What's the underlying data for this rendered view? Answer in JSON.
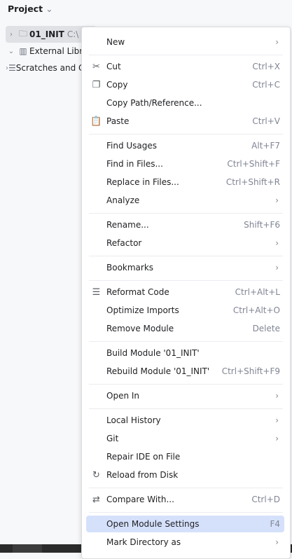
{
  "header": {
    "title": "Project"
  },
  "tree": [
    {
      "label": "01_INIT",
      "path": "C:\\",
      "expanded": false,
      "icon": "module-folder-icon",
      "selected": true
    },
    {
      "label": "External Libraries",
      "expanded": true,
      "icon": "library-icon"
    },
    {
      "label": "Scratches and Consoles",
      "expanded": false,
      "icon": "scratches-icon"
    }
  ],
  "menu": [
    {
      "label": "New",
      "submenu": true
    },
    {
      "sep": true
    },
    {
      "label": "Cut",
      "shortcut": "Ctrl+X",
      "icon": "scissors-icon",
      "glyph": "✂"
    },
    {
      "label": "Copy",
      "shortcut": "Ctrl+C",
      "icon": "copy-icon",
      "glyph": "❐"
    },
    {
      "label": "Copy Path/Reference..."
    },
    {
      "label": "Paste",
      "shortcut": "Ctrl+V",
      "icon": "paste-icon",
      "glyph": "📋"
    },
    {
      "sep": true
    },
    {
      "label": "Find Usages",
      "shortcut": "Alt+F7"
    },
    {
      "label": "Find in Files...",
      "shortcut": "Ctrl+Shift+F"
    },
    {
      "label": "Replace in Files...",
      "shortcut": "Ctrl+Shift+R"
    },
    {
      "label": "Analyze",
      "submenu": true
    },
    {
      "sep": true
    },
    {
      "label": "Rename...",
      "shortcut": "Shift+F6"
    },
    {
      "label": "Refactor",
      "submenu": true
    },
    {
      "sep": true
    },
    {
      "label": "Bookmarks",
      "submenu": true
    },
    {
      "sep": true
    },
    {
      "label": "Reformat Code",
      "shortcut": "Ctrl+Alt+L",
      "icon": "reformat-icon",
      "glyph": "☰"
    },
    {
      "label": "Optimize Imports",
      "shortcut": "Ctrl+Alt+O"
    },
    {
      "label": "Remove Module",
      "shortcut": "Delete"
    },
    {
      "sep": true
    },
    {
      "label": "Build Module '01_INIT'"
    },
    {
      "label": "Rebuild Module '01_INIT'",
      "shortcut": "Ctrl+Shift+F9"
    },
    {
      "sep": true
    },
    {
      "label": "Open In",
      "submenu": true
    },
    {
      "sep": true
    },
    {
      "label": "Local History",
      "submenu": true
    },
    {
      "label": "Git",
      "submenu": true
    },
    {
      "label": "Repair IDE on File"
    },
    {
      "label": "Reload from Disk",
      "icon": "reload-icon",
      "glyph": "↻"
    },
    {
      "sep": true
    },
    {
      "label": "Compare With...",
      "shortcut": "Ctrl+D",
      "icon": "compare-icon",
      "glyph": "⇄"
    },
    {
      "sep": true
    },
    {
      "label": "Open Module Settings",
      "shortcut": "F4",
      "highlighted": true
    },
    {
      "label": "Mark Directory as",
      "submenu": true
    }
  ],
  "colors": {
    "highlight": "#d5e1fb",
    "selection": "#dfe1e5"
  }
}
